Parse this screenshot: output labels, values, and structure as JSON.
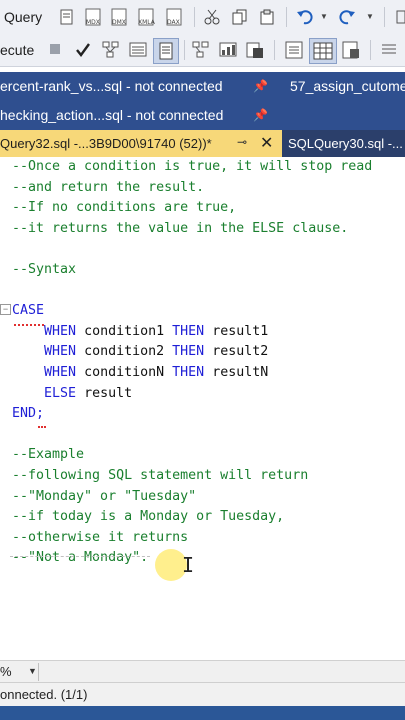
{
  "toolbar1": {
    "query_label": "Query",
    "icons": [
      "mdx-icon",
      "dmx-icon",
      "xmla-icon",
      "dax-icon",
      "cut-icon",
      "copy-icon",
      "paste-icon",
      "undo-icon",
      "redo-icon"
    ]
  },
  "toolbar2": {
    "execute_label": "ecute"
  },
  "tabs": {
    "row1_tab1": "ercent-rank_vs...sql - not connected",
    "row1_tab2": "57_assign_cutome",
    "row2_tab1": "hecking_action...sql - not connected",
    "active_tab": "Query32.sql -...3B9D00\\91740 (52))*",
    "inactive_tab": "SQLQuery30.sql -..."
  },
  "editor": {
    "lines": [
      {
        "text": "--Once a condition is true, it will stop read",
        "cls": "cm"
      },
      {
        "text": "--and return the result.",
        "cls": "cm"
      },
      {
        "text": "--If no conditions are true,",
        "cls": "cm"
      },
      {
        "text": "--it returns the value in the ELSE clause.",
        "cls": "cm"
      },
      {
        "text": "",
        "cls": "cm"
      },
      {
        "text": "--Syntax",
        "cls": "cm"
      },
      {
        "text": "",
        "cls": "cm"
      },
      {
        "text": "CASE",
        "cls": "kw"
      },
      {
        "text": "    WHEN condition1 THEN result1",
        "cls": "mix"
      },
      {
        "text": "    WHEN condition2 THEN result2",
        "cls": "mix"
      },
      {
        "text": "    WHEN conditionN THEN resultN",
        "cls": "mix"
      },
      {
        "text": "    ELSE result",
        "cls": "mix"
      },
      {
        "text": "END;",
        "cls": "kw"
      },
      {
        "text": "",
        "cls": "cm"
      },
      {
        "text": "--Example",
        "cls": "cm"
      },
      {
        "text": "--following SQL statement will return",
        "cls": "cm"
      },
      {
        "text": "--\"Monday\" or \"Tuesday\"",
        "cls": "cm"
      },
      {
        "text": "--if today is a Monday or Tuesday,",
        "cls": "cm"
      },
      {
        "text": "--otherwise it returns",
        "cls": "cm"
      },
      {
        "text": "--\"Not a Monday\".",
        "cls": "cm"
      }
    ]
  },
  "zoom": {
    "value": "%"
  },
  "status": {
    "text": "onnected. (1/1)"
  },
  "colors": {
    "tab_bar": "#2f4f8f",
    "active_tab": "#f7d879",
    "comment": "#1a7f2e",
    "keyword": "#1f1fd6"
  }
}
